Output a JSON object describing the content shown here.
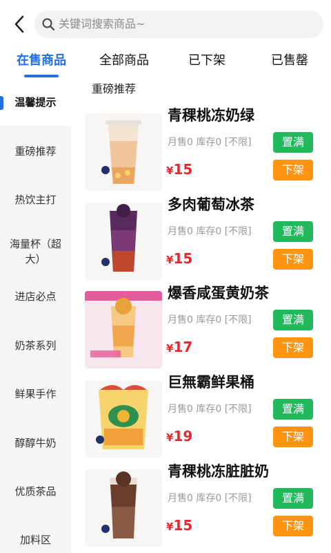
{
  "header": {
    "search_placeholder": "关键词搜索商品~"
  },
  "tabs": [
    {
      "label": "在售商品",
      "active": true
    },
    {
      "label": "全部商品",
      "active": false
    },
    {
      "label": "已下架",
      "active": false
    },
    {
      "label": "已售罄",
      "active": false
    }
  ],
  "sidebar": {
    "items": [
      {
        "label": "温馨提示",
        "active": true
      },
      {
        "label": "重磅推荐",
        "active": false
      },
      {
        "label": "热饮主打",
        "active": false
      },
      {
        "label": "海量杯（超大）",
        "active": false
      },
      {
        "label": "进店必点",
        "active": false
      },
      {
        "label": "奶茶系列",
        "active": false
      },
      {
        "label": "鲜果手作",
        "active": false
      },
      {
        "label": "醇醇牛奶",
        "active": false
      },
      {
        "label": "优质茶品",
        "active": false
      },
      {
        "label": "加料区",
        "active": false
      }
    ]
  },
  "section": {
    "title": "重磅推荐"
  },
  "buttons": {
    "fill_label": "置满",
    "delist_label": "下架"
  },
  "currency": "¥",
  "products": [
    {
      "name": "青稞桃冻奶绿",
      "stats": "月售0 库存0 [不限]",
      "price": "15"
    },
    {
      "name": "多肉葡萄冰茶",
      "stats": "月售0 库存0 [不限]",
      "price": "15"
    },
    {
      "name": "爆香咸蛋黄奶茶",
      "stats": "月售0 库存0 [不限]",
      "price": "17"
    },
    {
      "name": "巨無霸鲜果桶",
      "stats": "月售0 库存0 [不限]",
      "price": "19"
    },
    {
      "name": "青稞桃冻脏脏奶",
      "stats": "月售0 库存0 [不限]",
      "price": "15"
    }
  ],
  "colors": {
    "accent": "#1f6fe5",
    "fill_button": "#21b95c",
    "delist_button": "#ff9412",
    "price": "#e8262d"
  }
}
